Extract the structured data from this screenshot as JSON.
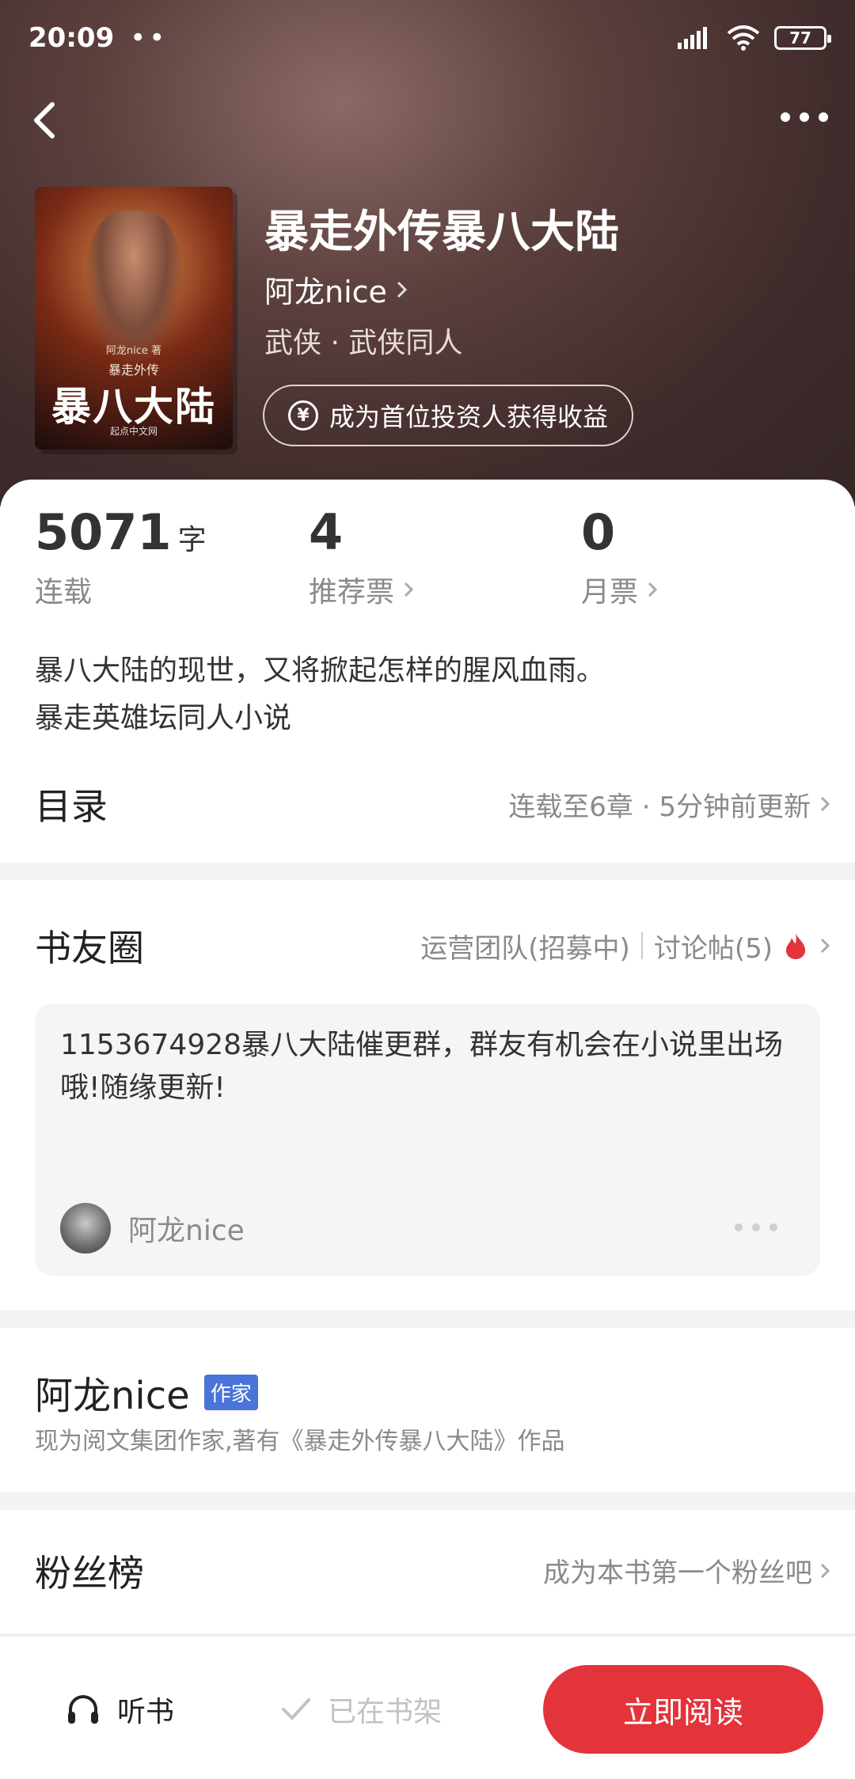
{
  "status_bar": {
    "time": "20:09",
    "dots": "••",
    "battery": "77"
  },
  "book": {
    "title": "暴走外传暴八大陆",
    "author": "阿龙nice",
    "genre": "武侠 · 武侠同人",
    "invest_label": "成为首位投资人获得收益",
    "cover": {
      "author_line": "阿龙nice 著",
      "series": "暴走外传",
      "title": "暴八大陆",
      "publisher": "起点中文网"
    }
  },
  "stats": [
    {
      "value": "5071",
      "unit": "字",
      "label": "连载"
    },
    {
      "value": "4",
      "label": "推荐票"
    },
    {
      "value": "0",
      "label": "月票"
    }
  ],
  "description": [
    "暴八大陆的现世，又将掀起怎样的腥风血雨。",
    "暴走英雄坛同人小说"
  ],
  "toc": {
    "label": "目录",
    "info": "连载至6章 · 5分钟前更新"
  },
  "circle": {
    "label": "书友圈",
    "team": "运营团队(招募中)",
    "posts_label": "讨论帖(5)",
    "post": {
      "text": "1153674928暴八大陆催更群，群友有机会在小说里出场哦!随缘更新!",
      "user": "阿龙nice"
    }
  },
  "author_section": {
    "name": "阿龙nice",
    "badge": "作家",
    "intro": "现为阅文集团作家,著有《暴走外传暴八大陆》作品"
  },
  "fans": {
    "label": "粉丝榜",
    "cta": "成为本书第一个粉丝吧"
  },
  "bottom_bar": {
    "listen": "听书",
    "shelf": "已在书架",
    "read": "立即阅读"
  },
  "colors": {
    "accent": "#e3333b",
    "badge": "#4a74d8",
    "fire": "#e3333b"
  },
  "icons": [
    "signal-icon",
    "wifi-icon",
    "battery-icon",
    "back-icon",
    "more-icon",
    "yen-icon",
    "chevron-right-icon",
    "fire-icon",
    "headphones-icon",
    "check-icon"
  ]
}
